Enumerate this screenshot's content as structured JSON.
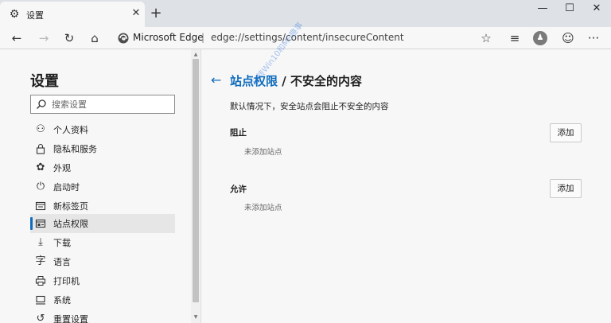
{
  "tab": {
    "title": "设置",
    "icon": "gear-icon",
    "close_glyph": "✕",
    "new_tab_glyph": "+"
  },
  "window_controls": {
    "minimize": "—",
    "maximize": "☐",
    "close": "✕"
  },
  "address_bar": {
    "brand": "Microsoft Edge",
    "separator": "|",
    "url": "edge://settings/content/insecureContent"
  },
  "toolbar_icons": {
    "back": "back-arrow-icon",
    "forward": "forward-arrow-icon",
    "refresh": "refresh-icon",
    "home": "home-icon",
    "favorite": "star-icon",
    "favorites": "favorites-list-icon",
    "profile": "profile-avatar",
    "feedback": "smiley-icon",
    "more": "more-icon"
  },
  "sidebar": {
    "title": "设置",
    "search_placeholder": "搜索设置",
    "items": [
      {
        "label": "个人资料",
        "icon": "person-icon"
      },
      {
        "label": "隐私和服务",
        "icon": "lock-icon"
      },
      {
        "label": "外观",
        "icon": "palette-icon"
      },
      {
        "label": "启动时",
        "icon": "power-icon"
      },
      {
        "label": "新标签页",
        "icon": "new-tab-icon"
      },
      {
        "label": "站点权限",
        "icon": "site-permissions-icon",
        "active": true
      },
      {
        "label": "下载",
        "icon": "download-icon"
      },
      {
        "label": "语言",
        "icon": "language-icon"
      },
      {
        "label": "打印机",
        "icon": "printer-icon"
      },
      {
        "label": "系统",
        "icon": "system-icon"
      },
      {
        "label": "重置设置",
        "icon": "reset-icon"
      }
    ]
  },
  "main": {
    "breadcrumb_link": "站点权限",
    "breadcrumb_sep": " / ",
    "breadcrumb_current": "不安全的内容",
    "description": "默认情况下，安全站点会阻止不安全的内容",
    "block": {
      "title": "阻止",
      "empty": "未添加站点",
      "button": "添加"
    },
    "allow": {
      "title": "允许",
      "empty": "未添加站点",
      "button": "添加"
    }
  },
  "watermark": "玩转Win10和MS趣事"
}
